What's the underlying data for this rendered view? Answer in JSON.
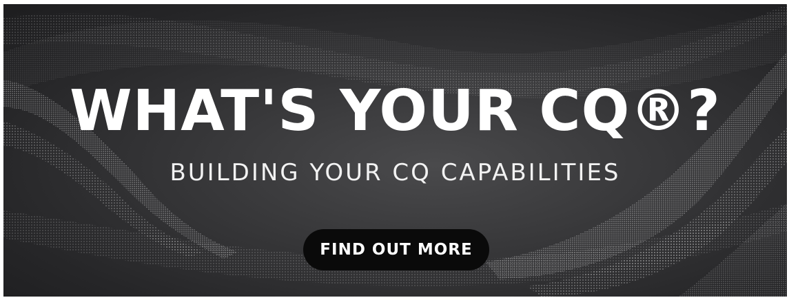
{
  "banner": {
    "headline": "WHAT'S YOUR CQ®?",
    "subheadline": "BUILDING YOUR CQ CAPABILITIES",
    "cta_label": "FIND OUT MORE"
  },
  "colors": {
    "background": "#2e2e30",
    "text": "#ffffff",
    "button_bg": "#0a0a0a",
    "wave_dots": "#ffffff"
  }
}
